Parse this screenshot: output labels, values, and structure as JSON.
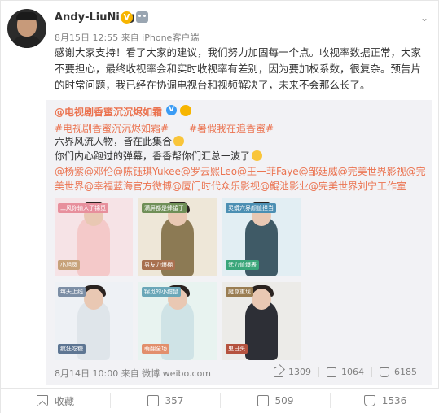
{
  "post": {
    "username": "Andy-LiuNing",
    "verified_badge": "V",
    "meta": "8月15日 12:55 来自 iPhone客户端",
    "text": "感谢大家支持！看了大家的建议，我们努力加固每一个点。收视率数据正常，大家不要担心，最终收视率会和实时收视率有差别，因为要加权系数，很复杂。预告片的时常问题，我已经在协调电视台和视频解决了，未来不会那么长了。",
    "more_icon": "chevron-down-icon"
  },
  "repost": {
    "username": "@电视剧香蜜沉沉烬如霜",
    "verified_badge": "V",
    "topic_1": "#电视剧香蜜沉沉烬如霜#",
    "topic_2": "#暑假我在追香蜜#",
    "line_1": "六界风流人物，皆在此集合",
    "line_2": "你们内心跑过的弹幕，香香帮你们汇总一波了",
    "mentions": "@杨紫@邓伦@陈钰琪Yukee@罗云熙Leo@王一菲Faye@邹廷威@完美世界影视@完美世界@幸福蓝海官方微博@厦门时代众乐影视@鲲池影业@完美世界刘宁工作室",
    "footer": "8月14日 10:00 来自 微博 weibo.com",
    "stats": {
      "shares": "1309",
      "comments": "1064",
      "likes": "6185"
    },
    "thumbnails": [
      {
        "tag": "二风你输入了锦觅",
        "tag2": "小旭凤",
        "bg": "#f6e3e6",
        "outfit": "#f4c9c9"
      },
      {
        "tag": "满屏都是蜂蛰了",
        "tag2": "男友力爆棚",
        "bg": "#eee7d8",
        "outfit": "#8c7a54"
      },
      {
        "tag": "灵蟒六界颜值担当",
        "tag2": "武力值爆表",
        "bg": "#e2eef3",
        "outfit": "#3f5a66"
      },
      {
        "tag": "每天上线",
        "tag2": "疯狂吃糖",
        "bg": "#eef1f5",
        "outfit": "#dfe5ea"
      },
      {
        "tag": "锦觅的小甜鼠",
        "tag2": "萌翻全场",
        "bg": "#e8f3f0",
        "outfit": "#cfe3e6"
      },
      {
        "tag": "魔尊重现",
        "tag2": "鬼日头",
        "bg": "#ecebe8",
        "outfit": "#2d2f36"
      }
    ]
  },
  "actions": {
    "favorite_label": "收藏",
    "share_count": "357",
    "comment_count": "509",
    "like_count": "1536"
  }
}
